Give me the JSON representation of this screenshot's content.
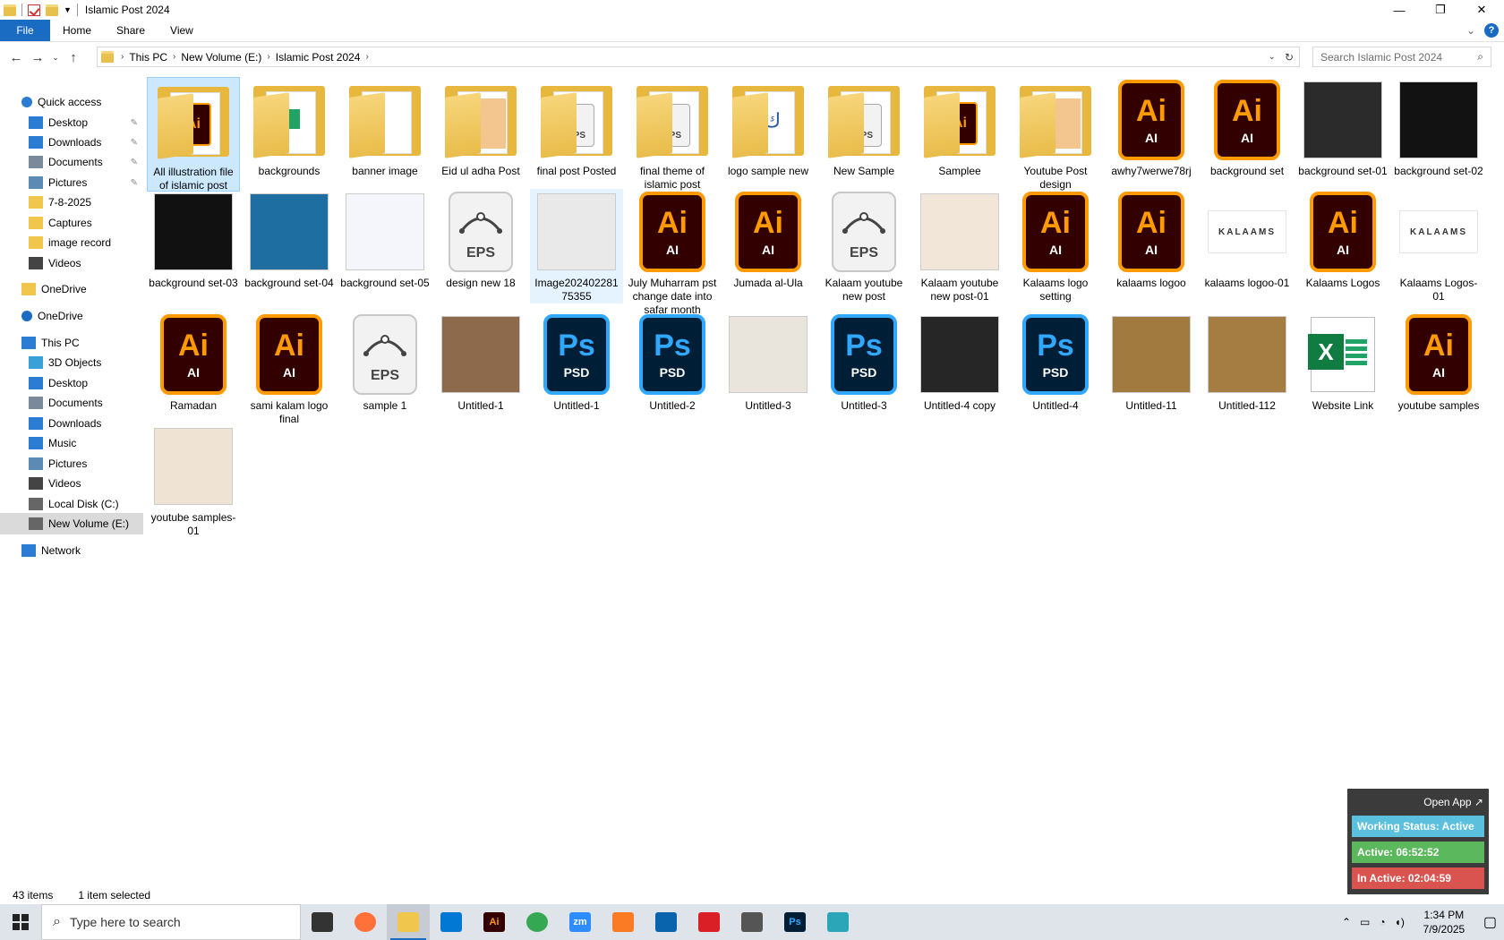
{
  "window": {
    "title": "Islamic Post 2024"
  },
  "ribbon": {
    "tabs": [
      "File",
      "Home",
      "Share",
      "View"
    ]
  },
  "address": {
    "crumbs": [
      "This PC",
      "New Volume (E:)",
      "Islamic Post 2024"
    ],
    "search_placeholder": "Search Islamic Post 2024"
  },
  "nav": [
    {
      "label": "Quick access",
      "icon": "star-icon",
      "pinned": false
    },
    {
      "label": "Desktop",
      "icon": "desktop-icon",
      "pinned": true
    },
    {
      "label": "Downloads",
      "icon": "download-icon",
      "pinned": true
    },
    {
      "label": "Documents",
      "icon": "documents-icon",
      "pinned": true
    },
    {
      "label": "Pictures",
      "icon": "pictures-icon",
      "pinned": true
    },
    {
      "label": "7-8-2025",
      "icon": "folder-icon",
      "pinned": false
    },
    {
      "label": "Captures",
      "icon": "folder-icon",
      "pinned": false
    },
    {
      "label": "image record",
      "icon": "folder-icon",
      "pinned": false
    },
    {
      "label": "Videos",
      "icon": "videos-icon",
      "pinned": false
    },
    {
      "label": "OneDrive",
      "icon": "folder-icon",
      "pinned": false
    },
    {
      "label": "OneDrive",
      "icon": "cloud-icon",
      "pinned": false
    },
    {
      "label": "This PC",
      "icon": "computer-icon",
      "pinned": false
    },
    {
      "label": "3D Objects",
      "icon": "cube-icon",
      "pinned": false
    },
    {
      "label": "Desktop",
      "icon": "desktop-icon",
      "pinned": false
    },
    {
      "label": "Documents",
      "icon": "documents-icon",
      "pinned": false
    },
    {
      "label": "Downloads",
      "icon": "download-icon",
      "pinned": false
    },
    {
      "label": "Music",
      "icon": "music-icon",
      "pinned": false
    },
    {
      "label": "Pictures",
      "icon": "pictures-icon",
      "pinned": false
    },
    {
      "label": "Videos",
      "icon": "videos-icon",
      "pinned": false
    },
    {
      "label": "Local Disk (C:)",
      "icon": "drive-icon",
      "pinned": false
    },
    {
      "label": "New Volume (E:)",
      "icon": "drive-icon",
      "pinned": false
    },
    {
      "label": "Network",
      "icon": "network-icon",
      "pinned": false
    }
  ],
  "files": [
    {
      "name": "All illustration file of islamic post",
      "kind": "folder",
      "badge": "AI"
    },
    {
      "name": "backgrounds",
      "kind": "folder",
      "badge": "sheet"
    },
    {
      "name": "banner image",
      "kind": "folder",
      "badge": "doc"
    },
    {
      "name": "Eid ul adha Post",
      "kind": "folder",
      "badge": "img"
    },
    {
      "name": "final post Posted",
      "kind": "folder",
      "badge": "EPS"
    },
    {
      "name": "final theme of islamic post",
      "kind": "folder",
      "badge": "EPS"
    },
    {
      "name": "logo sample new",
      "kind": "folder",
      "badge": "logo"
    },
    {
      "name": "New Sample",
      "kind": "folder",
      "badge": "EPS"
    },
    {
      "name": "Samplee",
      "kind": "folder",
      "badge": "AI"
    },
    {
      "name": "Youtube Post design",
      "kind": "folder",
      "badge": "img"
    },
    {
      "name": "awhy7werwe78rj",
      "kind": "ai"
    },
    {
      "name": "background set",
      "kind": "ai"
    },
    {
      "name": "background set-01",
      "kind": "image",
      "color": "#2b2b2b"
    },
    {
      "name": "background set-02",
      "kind": "image",
      "color": "#121212"
    },
    {
      "name": "background set-03",
      "kind": "image",
      "color": "#111111"
    },
    {
      "name": "background set-04",
      "kind": "image",
      "color": "#1f6ea1"
    },
    {
      "name": "background set-05",
      "kind": "image",
      "color": "#f4f6fb"
    },
    {
      "name": "design new 18",
      "kind": "eps"
    },
    {
      "name": "Image20240228175355",
      "kind": "image",
      "color": "#e9e9e9"
    },
    {
      "name": "July Muharram pst change date into safar month",
      "kind": "ai"
    },
    {
      "name": "Jumada al-Ula",
      "kind": "ai"
    },
    {
      "name": "Kalaam youtube new post",
      "kind": "eps"
    },
    {
      "name": "Kalaam youtube new post-01",
      "kind": "image",
      "color": "#f1e6d8"
    },
    {
      "name": "Kalaams logo setting",
      "kind": "ai"
    },
    {
      "name": "kalaams logoo",
      "kind": "ai"
    },
    {
      "name": "kalaams logoo-01",
      "kind": "logo",
      "text": "KALAAMS"
    },
    {
      "name": "Kalaams Logos",
      "kind": "ai"
    },
    {
      "name": "Kalaams Logos-01",
      "kind": "logo",
      "text": "KALAAMS"
    },
    {
      "name": "Ramadan",
      "kind": "ai"
    },
    {
      "name": "sami kalam logo final",
      "kind": "ai"
    },
    {
      "name": "sample 1",
      "kind": "eps"
    },
    {
      "name": "Untitled-1",
      "kind": "image",
      "color": "#8c6a4b"
    },
    {
      "name": "Untitled-1",
      "kind": "ps"
    },
    {
      "name": "Untitled-2",
      "kind": "ps"
    },
    {
      "name": "Untitled-3",
      "kind": "image",
      "color": "#e9e4dc"
    },
    {
      "name": "Untitled-3",
      "kind": "ps"
    },
    {
      "name": "Untitled-4 copy",
      "kind": "image",
      "color": "#262626"
    },
    {
      "name": "Untitled-4",
      "kind": "ps"
    },
    {
      "name": "Untitled-11",
      "kind": "image",
      "color": "#a07a3e"
    },
    {
      "name": "Untitled-112",
      "kind": "image",
      "color": "#a57d42"
    },
    {
      "name": "Website Link",
      "kind": "excel"
    },
    {
      "name": "youtube samples",
      "kind": "ai"
    },
    {
      "name": "youtube samples-01",
      "kind": "image",
      "color": "#efe3d4"
    }
  ],
  "status": {
    "items": "43 items",
    "selected": "1 item selected"
  },
  "widget": {
    "open": "Open App ↗",
    "working": "Working Status: Active",
    "active": "Active: 06:52:52",
    "inactive": "In Active: 02:04:59",
    "colors": {
      "working": "#5bc0de",
      "active": "#5cb85c",
      "inactive": "#d9534f"
    }
  },
  "taskbar": {
    "search_placeholder": "Type here to search",
    "time": "1:34 PM",
    "date": "7/9/2025",
    "apps": [
      "task-view-icon",
      "firefox-icon",
      "file-explorer-icon",
      "vscode-icon",
      "illustrator-icon",
      "chrome-icon",
      "zoom-icon",
      "xampp-icon",
      "outlook-icon",
      "creative-cloud-icon",
      "pen-tool-icon",
      "photoshop-icon",
      "app-icon"
    ],
    "app_labels": [
      "",
      "",
      "",
      "",
      "Ai",
      "",
      "zm",
      "",
      "",
      "",
      "",
      "Ps",
      ""
    ]
  }
}
